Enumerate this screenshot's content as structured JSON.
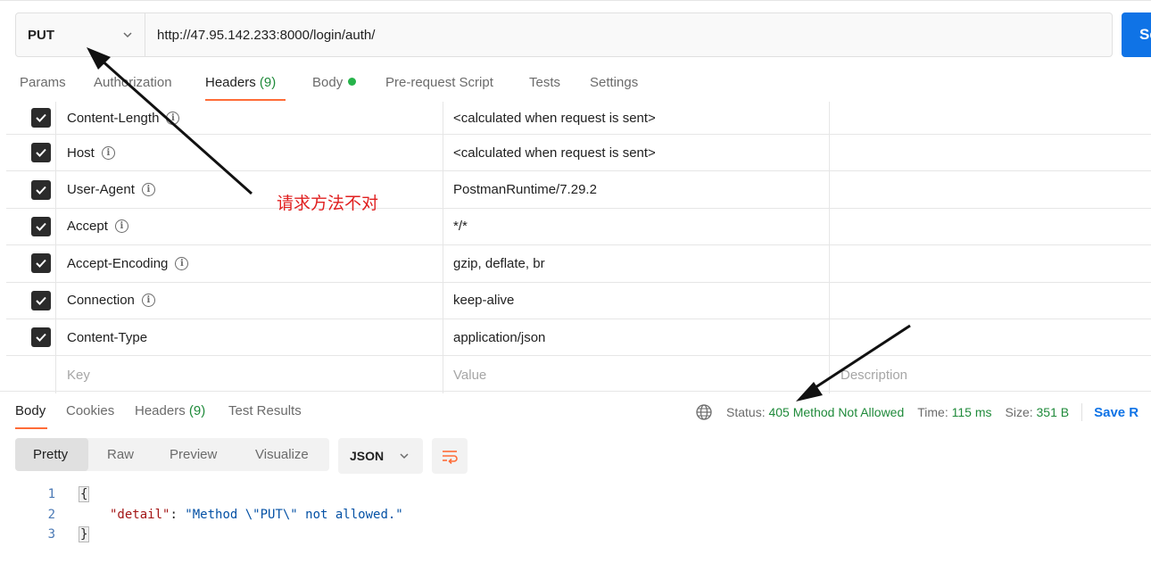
{
  "request": {
    "method": "PUT",
    "url": "http://47.95.142.233:8000/login/auth/",
    "send_label": "Se"
  },
  "request_tabs": [
    {
      "label": "Params"
    },
    {
      "label": "Authorization"
    },
    {
      "label": "Headers",
      "count": "(9)",
      "active": true
    },
    {
      "label": "Body",
      "has_dot": true
    },
    {
      "label": "Pre-request Script"
    },
    {
      "label": "Tests"
    },
    {
      "label": "Settings"
    }
  ],
  "headers": [
    {
      "key": "Content-Length",
      "value": "<calculated when request is sent>",
      "checked": true,
      "info": true
    },
    {
      "key": "Host",
      "value": "<calculated when request is sent>",
      "checked": true,
      "info": true
    },
    {
      "key": "User-Agent",
      "value": "PostmanRuntime/7.29.2",
      "checked": true,
      "info": true
    },
    {
      "key": "Accept",
      "value": "*/*",
      "checked": true,
      "info": true
    },
    {
      "key": "Accept-Encoding",
      "value": "gzip, deflate, br",
      "checked": true,
      "info": true
    },
    {
      "key": "Connection",
      "value": "keep-alive",
      "checked": true,
      "info": true
    },
    {
      "key": "Content-Type",
      "value": "application/json",
      "checked": true,
      "info": false
    }
  ],
  "new_row": {
    "key_placeholder": "Key",
    "value_placeholder": "Value",
    "description_placeholder": "Description"
  },
  "response_tabs": [
    {
      "label": "Body",
      "active": true
    },
    {
      "label": "Cookies"
    },
    {
      "label": "Headers",
      "count": "(9)"
    },
    {
      "label": "Test Results"
    }
  ],
  "response_status": {
    "status_label": "Status:",
    "status_value": "405 Method Not Allowed",
    "time_label": "Time:",
    "time_value": "115 ms",
    "size_label": "Size:",
    "size_value": "351 B",
    "save_label": "Save R"
  },
  "view_modes": [
    "Pretty",
    "Raw",
    "Preview",
    "Visualize"
  ],
  "format": "JSON",
  "response_body": {
    "line_numbers": [
      "1",
      "2",
      "3"
    ],
    "open_brace": "{",
    "key": "\"detail\"",
    "colon": ": ",
    "value": "\"Method \\\"PUT\\\" not allowed.\"",
    "close_brace": "}"
  },
  "annotation": {
    "text": "请求方法不对",
    "color": "#e02020"
  },
  "colors": {
    "accent": "#ff6c37",
    "send": "#0f73e6",
    "status_ok": "#1f8a3a"
  }
}
